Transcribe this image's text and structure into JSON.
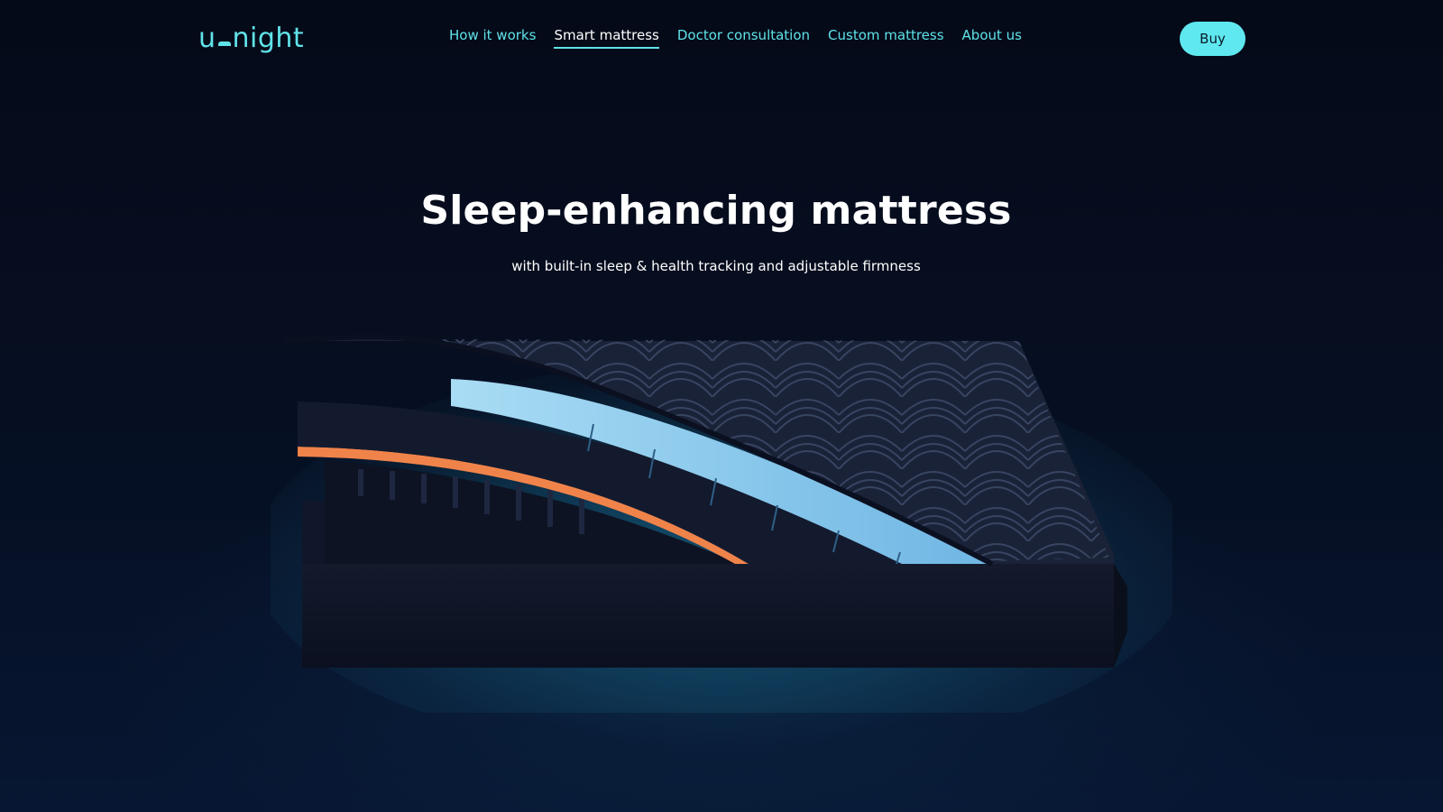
{
  "header": {
    "logo_text_left": "u",
    "logo_text_right": "night",
    "nav": [
      {
        "label": "How it works",
        "active": false
      },
      {
        "label": "Smart mattress",
        "active": true
      },
      {
        "label": "Doctor consultation",
        "active": false
      },
      {
        "label": "Custom mattress",
        "active": false
      },
      {
        "label": "About us",
        "active": false
      }
    ],
    "buy_label": "Buy"
  },
  "hero": {
    "title": "Sleep-enhancing mattress",
    "subtitle": "with built-in sleep & health tracking and adjustable firmness"
  },
  "colors": {
    "accent": "#5fe3e8",
    "background": "#060c1c",
    "orange_layer": "#f0834a",
    "blue_layer": "#9fd6f0"
  },
  "icons": {
    "logo": "unight-logo",
    "hero_image": "mattress-layers-illustration"
  }
}
